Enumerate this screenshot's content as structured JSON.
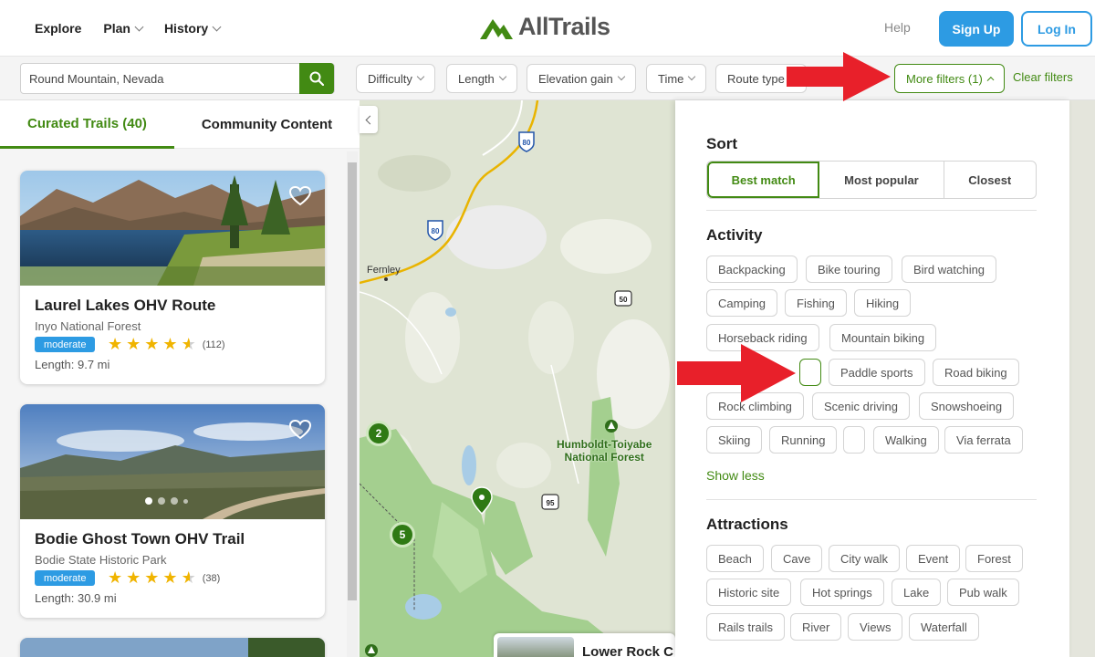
{
  "header": {
    "nav": [
      "Explore",
      "Plan",
      "History"
    ],
    "logo_text": "AllTrails",
    "help": "Help",
    "signup": "Sign Up",
    "login": "Log In"
  },
  "filters": {
    "search_value": "Round Mountain, Nevada",
    "chips": [
      "Difficulty",
      "Length",
      "Elevation gain",
      "Time",
      "Route type"
    ],
    "more_filters": "More filters (1)",
    "clear": "Clear filters"
  },
  "tabs": {
    "curated": "Curated Trails (40)",
    "community": "Community Content"
  },
  "trails": [
    {
      "name": "Laurel Lakes OHV Route",
      "area": "Inyo National Forest",
      "difficulty": "moderate",
      "rating": 4.5,
      "reviews": "(112)",
      "length": "Length: 9.7 mi"
    },
    {
      "name": "Bodie Ghost Town OHV Trail",
      "area": "Bodie State Historic Park",
      "difficulty": "moderate",
      "rating": 4.5,
      "reviews": "(38)",
      "length": "Length: 30.9 mi"
    }
  ],
  "map": {
    "labels": {
      "town": "Fernley",
      "forest_line1": "Humboldt-Toiyabe",
      "forest_line2": "National Forest"
    },
    "shields": [
      "80",
      "80",
      "50",
      "95"
    ],
    "clusters": [
      "2",
      "5"
    ],
    "peek_title": "Lower Rock C"
  },
  "panel": {
    "sort_title": "Sort",
    "sort_options": [
      "Best match",
      "Most popular",
      "Closest"
    ],
    "activity_title": "Activity",
    "activities": [
      "Backpacking",
      "Bike touring",
      "Bird watching",
      "Camping",
      "Fishing",
      "Hiking",
      "Horseback riding",
      "Mountain biking",
      "Paddle sports",
      "Road biking",
      "Rock climbing",
      "Scenic driving",
      "Snowshoeing",
      "Skiing",
      "Running",
      "Walking",
      "Via ferrata"
    ],
    "show_less": "Show less",
    "attractions_title": "Attractions",
    "attractions": [
      "Beach",
      "Cave",
      "City walk",
      "Event",
      "Forest",
      "Historic site",
      "Hot springs",
      "Lake",
      "Pub walk",
      "Rails trails",
      "River",
      "Views",
      "Waterfall"
    ]
  },
  "colors": {
    "brand_green": "#428a13",
    "blue": "#2d9be3",
    "arrow_red": "#e8202a"
  }
}
